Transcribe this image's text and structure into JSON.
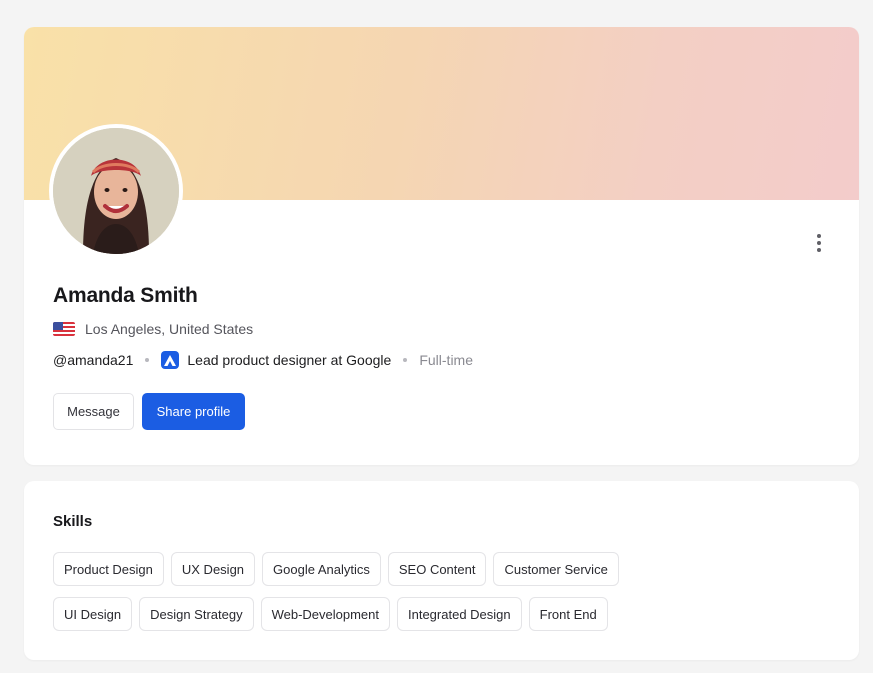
{
  "profile": {
    "name": "Amanda Smith",
    "location": "Los Angeles, United States",
    "handle": "@amanda21",
    "job_title": "Lead product designer at Google",
    "employment_type": "Full-time",
    "avatar_icon": "user-avatar-photo",
    "flag_icon": "us-flag-icon",
    "company_icon": "company-logo-icon"
  },
  "actions": {
    "message_label": "Message",
    "share_label": "Share profile"
  },
  "skills": {
    "title": "Skills",
    "row1": [
      "Product Design",
      "UX Design",
      "Google Analytics",
      "SEO Content",
      "Customer Service"
    ],
    "row2": [
      "UI Design",
      "Design Strategy",
      "Web-Development",
      "Integrated Design",
      "Front End"
    ]
  },
  "colors": {
    "primary": "#1b5de3",
    "cover_start": "#f9e1a8",
    "cover_end": "#f3cccb",
    "page_background": "#f4f4f4"
  }
}
